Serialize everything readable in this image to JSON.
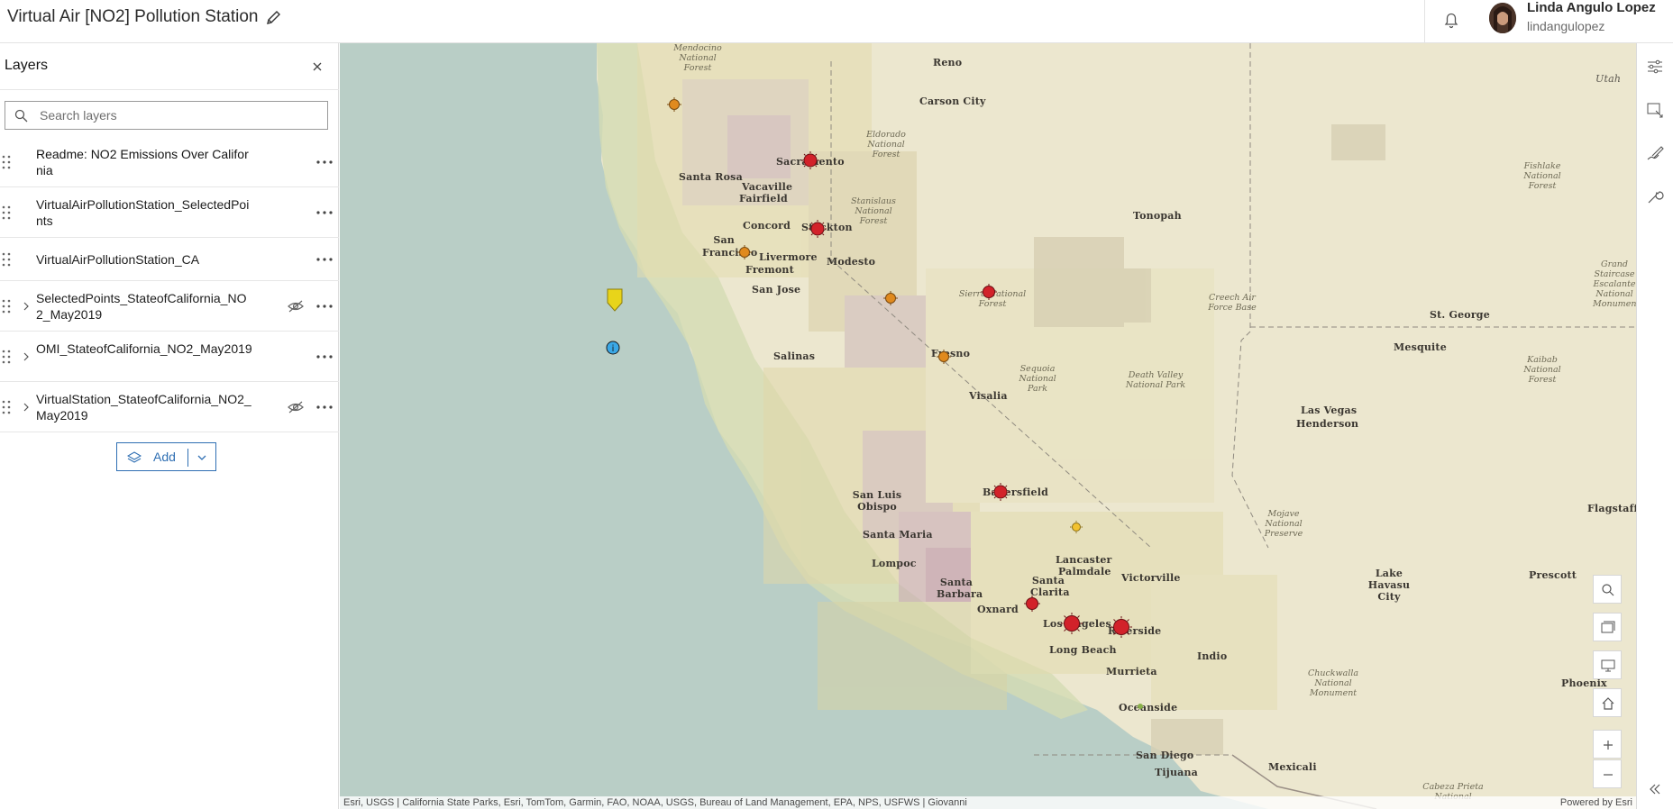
{
  "header": {
    "title": "Virtual Air [NO2] Pollution Station",
    "user_name": "Linda Angulo Lopez",
    "user_handle": "lindangulopez",
    "edit_icon": "pencil-icon",
    "notifications_icon": "bell-icon"
  },
  "layers_panel": {
    "title": "Layers",
    "search_placeholder": "Search layers",
    "add_label": "Add",
    "items": [
      {
        "label": "Readme: NO2 Emissions Over California",
        "expandable": false,
        "visibility_toggle": false
      },
      {
        "label": "VirtualAirPollutionStation_SelectedPoints",
        "expandable": false,
        "visibility_toggle": false
      },
      {
        "label": "VirtualAirPollutionStation_CA",
        "expandable": false,
        "visibility_toggle": false
      },
      {
        "label": "SelectedPoints_StateofCalifornia_NO2_May2019",
        "expandable": true,
        "visibility_toggle": true
      },
      {
        "label": "OMI_StateofCalifornia_NO2_May2019",
        "expandable": true,
        "visibility_toggle": false
      },
      {
        "label": "VirtualStation_StateofCalifornia_NO2_May2019",
        "expandable": true,
        "visibility_toggle": true
      }
    ]
  },
  "map": {
    "cities": [
      "Reno",
      "Carson City",
      "Sacramento",
      "Santa Rosa",
      "Vacaville",
      "Fairfield",
      "Concord",
      "Stockton",
      "San Francisco",
      "Livermore",
      "Fremont",
      "Modesto",
      "San Jose",
      "Salinas",
      "Fresno",
      "Visalia",
      "San Luis Obispo",
      "Santa Maria",
      "Lompoc",
      "Bakersfield",
      "Santa Barbara",
      "Oxnard",
      "Santa Clarita",
      "Lancaster",
      "Palmdale",
      "Victorville",
      "Los Angeles",
      "Riverside",
      "Long Beach",
      "Murrieta",
      "Indio",
      "Oceanside",
      "San Diego",
      "Tijuana",
      "Mexicali",
      "Tonopah",
      "Las Vegas",
      "Henderson",
      "Mesquite",
      "St. George",
      "Utah",
      "Flagstaff",
      "Prescott",
      "Lake Havasu City",
      "Phoenix"
    ],
    "parks": [
      "Mendocino National Forest",
      "Eldorado National Forest",
      "Stanislaus National Forest",
      "Sierra National Forest",
      "Sequoia National Park",
      "Death Valley National Park",
      "Creech Air Force Base",
      "Mojave National Preserve",
      "Chuckwalla National Monument",
      "Fishlake National Forest",
      "Grand Staircase Escalante National Monument",
      "Kaibab National Forest",
      "Cabeza Prieta National"
    ],
    "attribution": "Esri, USGS | California State Parks, Esri, TomTom, Garmin, FAO, NOAA, USGS, Bureau of Land Management, EPA, NPS, USFWS | Giovanni",
    "powered_by": "Powered by Esri",
    "colors": {
      "water": "#b9cec6",
      "land": "#ece7cf",
      "high_no2": "#b97a9a",
      "marker_high": "#d2222a",
      "marker_mid": "#e08a1e",
      "marker_low": "#f2c230"
    }
  },
  "map_tools": [
    "search-icon",
    "basemap-gallery-icon",
    "screen-icon",
    "home-icon",
    "zoom-in-icon",
    "zoom-out-icon"
  ],
  "rail_tools": [
    "settings-sliders-icon",
    "layer-properties-icon",
    "sketch-icon",
    "wrench-icon",
    "collapse-icon"
  ]
}
